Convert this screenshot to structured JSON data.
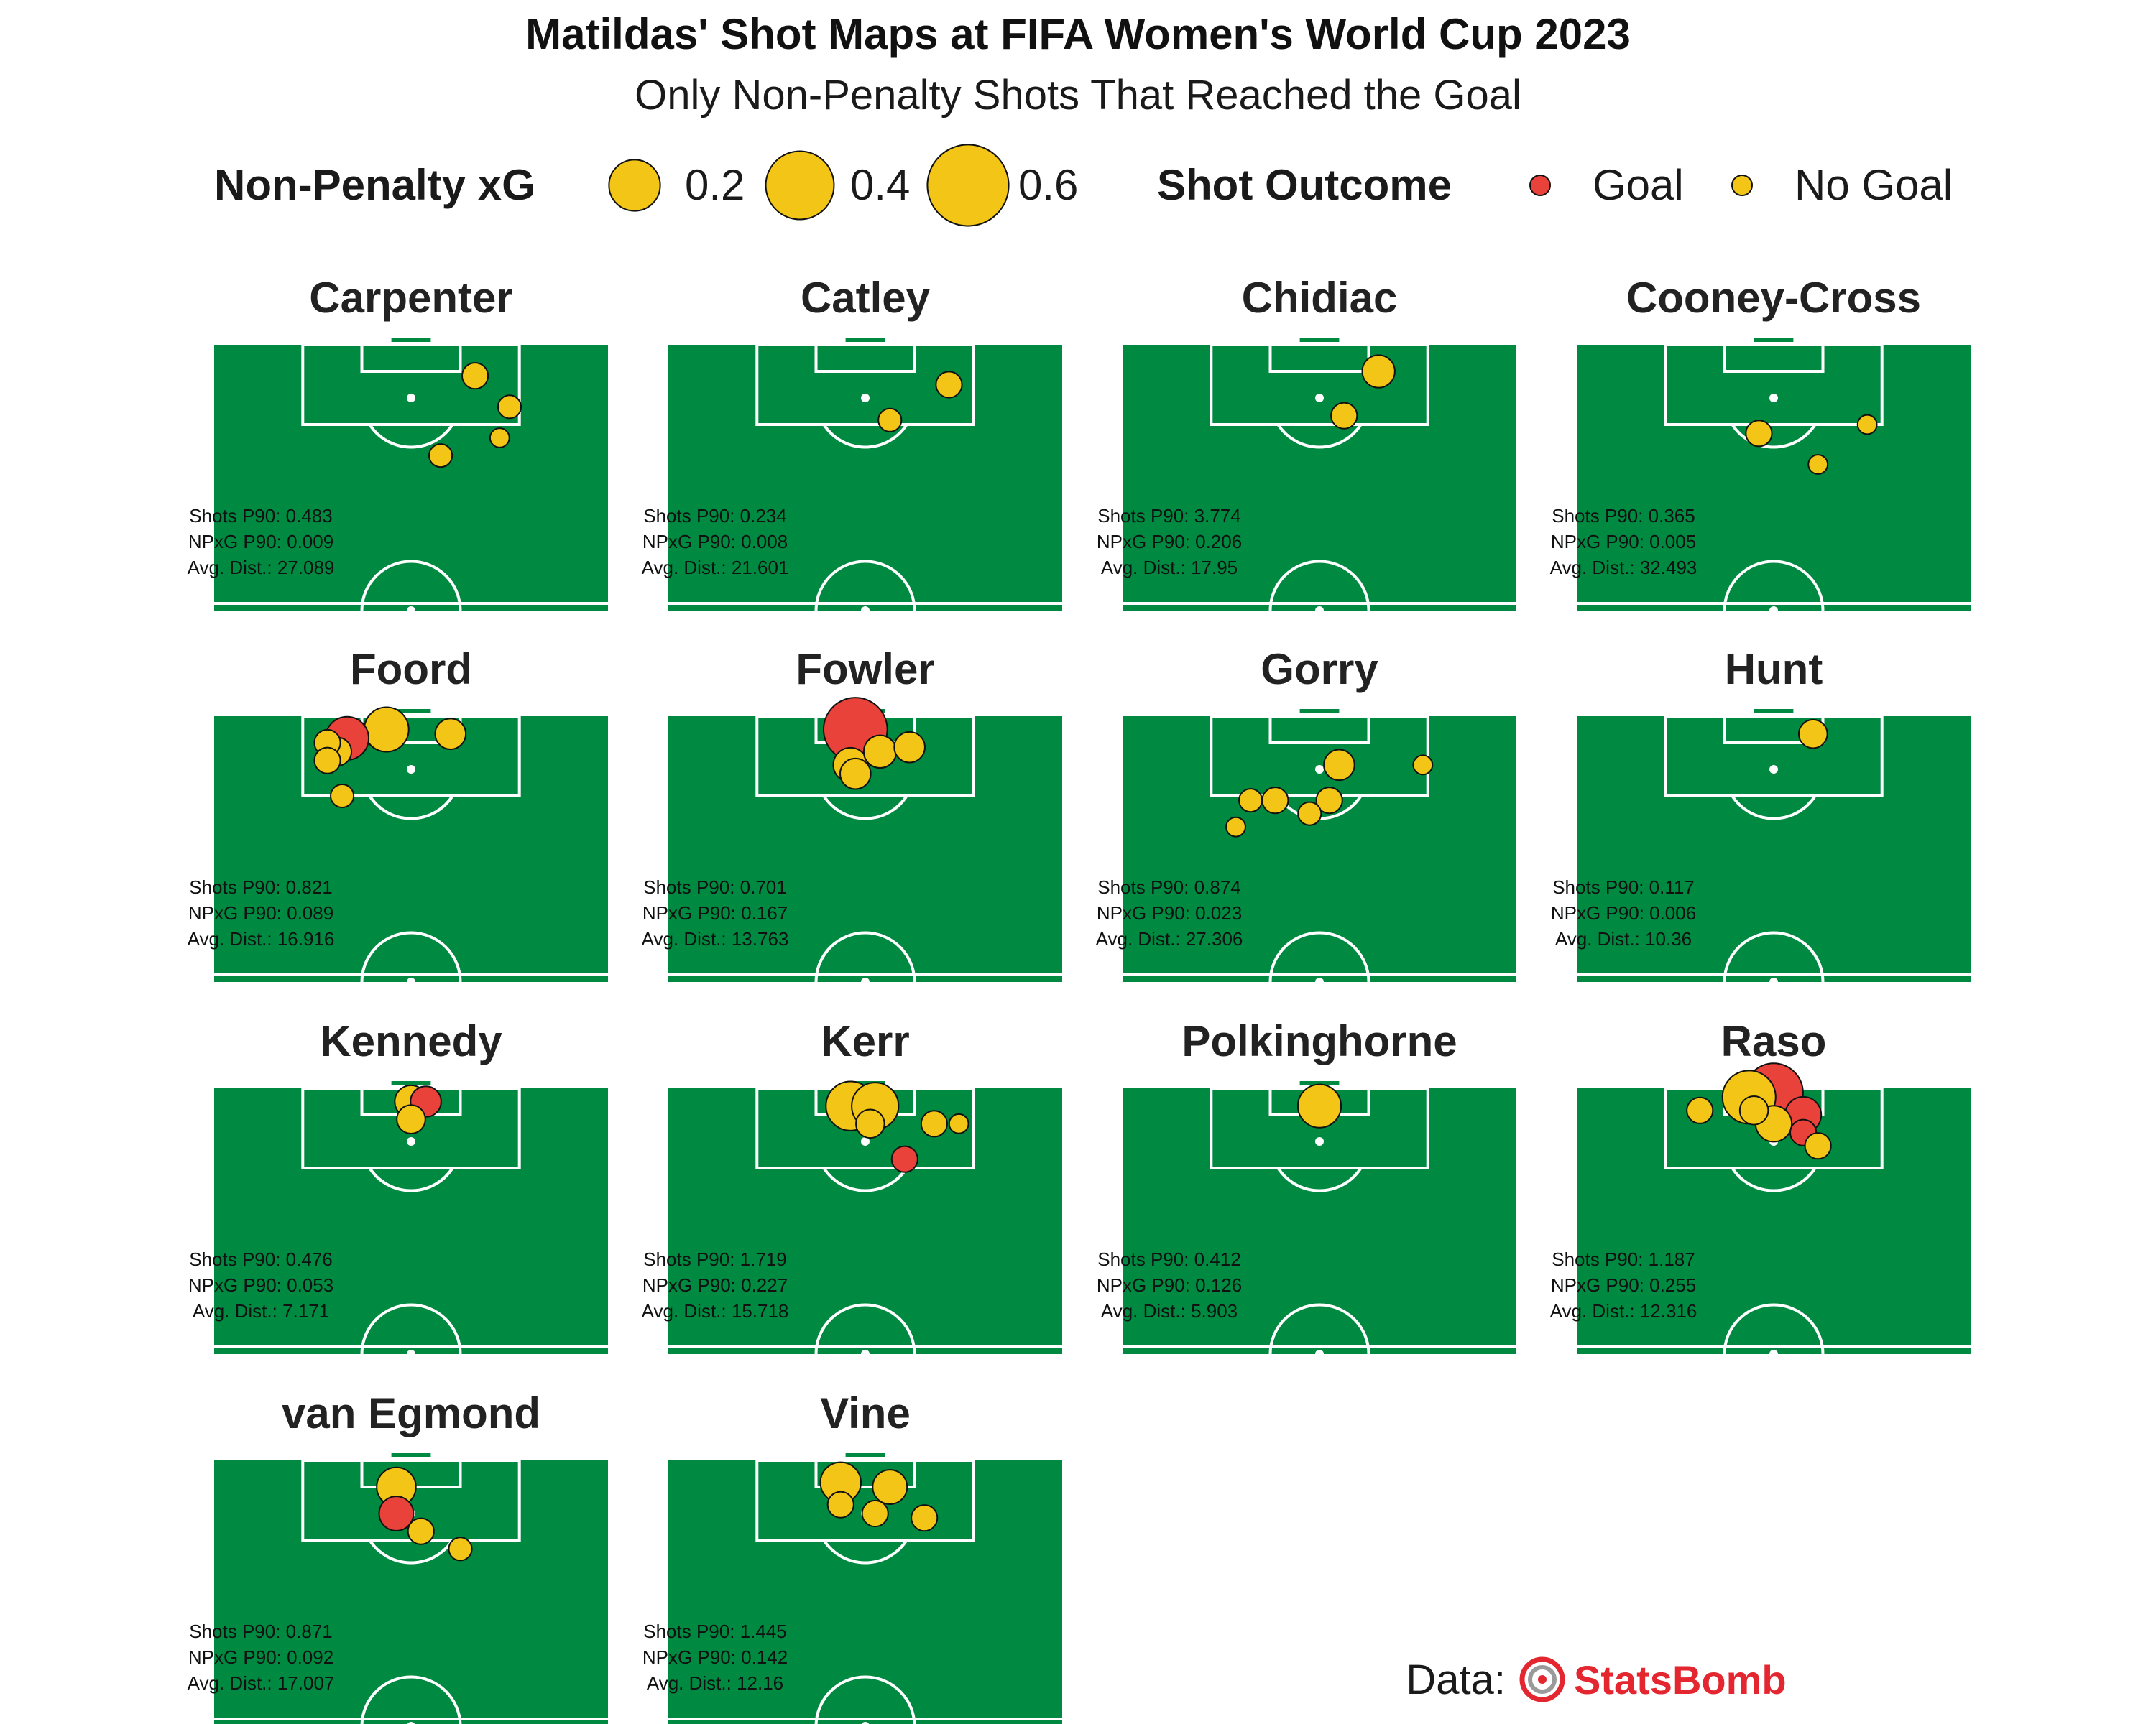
{
  "title": "Matildas' Shot Maps at FIFA Women's World Cup 2023",
  "subtitle": "Only Non-Penalty Shots That Reached the Goal",
  "legend": {
    "size_title": "Non-Penalty xG",
    "size_items": [
      {
        "label": "0.2",
        "value": 0.2
      },
      {
        "label": "0.4",
        "value": 0.4
      },
      {
        "label": "0.6",
        "value": 0.6
      }
    ],
    "color_title": "Shot Outcome",
    "color_items": [
      {
        "label": "Goal",
        "color": "#e8423a"
      },
      {
        "label": "No Goal",
        "color": "#f2c517"
      }
    ]
  },
  "colors": {
    "pitch": "#008940",
    "lines": "#ffffff",
    "goal": "#e8423a",
    "no_goal": "#f2c517"
  },
  "stat_labels": {
    "shots": "Shots P90: ",
    "npxg": "NPxG P90: ",
    "dist": "Avg. Dist.: "
  },
  "credit": {
    "prefix": "Data:",
    "brand": "StatsBomb",
    "logo_icon": "statsbomb-target-icon"
  },
  "chart_data": {
    "type": "scatter",
    "x_range": [
      0,
      80
    ],
    "y_range": [
      60,
      120
    ],
    "panels": [
      {
        "player": "Carpenter",
        "shots_p90": "0.483",
        "npxg_p90": "0.009",
        "avg_dist": "27.089",
        "shots": [
          {
            "x": 53,
            "y": 113,
            "xg": 0.03,
            "outcome": "No Goal"
          },
          {
            "x": 60,
            "y": 106,
            "xg": 0.02,
            "outcome": "No Goal"
          },
          {
            "x": 58,
            "y": 99,
            "xg": 0.01,
            "outcome": "No Goal"
          },
          {
            "x": 46,
            "y": 95,
            "xg": 0.02,
            "outcome": "No Goal"
          }
        ]
      },
      {
        "player": "Catley",
        "shots_p90": "0.234",
        "npxg_p90": "0.008",
        "avg_dist": "21.601",
        "shots": [
          {
            "x": 57,
            "y": 111,
            "xg": 0.03,
            "outcome": "No Goal"
          },
          {
            "x": 45,
            "y": 103,
            "xg": 0.02,
            "outcome": "No Goal"
          }
        ]
      },
      {
        "player": "Chidiac",
        "shots_p90": "3.774",
        "npxg_p90": "0.206",
        "avg_dist": "17.95",
        "shots": [
          {
            "x": 52,
            "y": 114,
            "xg": 0.06,
            "outcome": "No Goal"
          },
          {
            "x": 45,
            "y": 104,
            "xg": 0.03,
            "outcome": "No Goal"
          }
        ]
      },
      {
        "player": "Cooney-Cross",
        "shots_p90": "0.365",
        "npxg_p90": "0.005",
        "avg_dist": "32.493",
        "shots": [
          {
            "x": 37,
            "y": 100,
            "xg": 0.03,
            "outcome": "No Goal"
          },
          {
            "x": 59,
            "y": 102,
            "xg": 0.01,
            "outcome": "No Goal"
          },
          {
            "x": 49,
            "y": 93,
            "xg": 0.01,
            "outcome": "No Goal"
          }
        ]
      },
      {
        "player": "Foord",
        "shots_p90": "0.821",
        "npxg_p90": "0.089",
        "avg_dist": "16.916",
        "shots": [
          {
            "x": 35,
            "y": 117,
            "xg": 0.14,
            "outcome": "No Goal"
          },
          {
            "x": 27,
            "y": 115,
            "xg": 0.13,
            "outcome": "Goal"
          },
          {
            "x": 48,
            "y": 116,
            "xg": 0.05,
            "outcome": "No Goal"
          },
          {
            "x": 23,
            "y": 114,
            "xg": 0.03,
            "outcome": "No Goal"
          },
          {
            "x": 25,
            "y": 112,
            "xg": 0.04,
            "outcome": "No Goal"
          },
          {
            "x": 23,
            "y": 110,
            "xg": 0.03,
            "outcome": "No Goal"
          },
          {
            "x": 26,
            "y": 102,
            "xg": 0.02,
            "outcome": "No Goal"
          }
        ]
      },
      {
        "player": "Fowler",
        "shots_p90": "0.701",
        "npxg_p90": "0.167",
        "avg_dist": "13.763",
        "shots": [
          {
            "x": 38,
            "y": 117,
            "xg": 0.34,
            "outcome": "Goal"
          },
          {
            "x": 43,
            "y": 112,
            "xg": 0.06,
            "outcome": "No Goal"
          },
          {
            "x": 49,
            "y": 113,
            "xg": 0.05,
            "outcome": "No Goal"
          },
          {
            "x": 37,
            "y": 109,
            "xg": 0.07,
            "outcome": "No Goal"
          },
          {
            "x": 38,
            "y": 107,
            "xg": 0.05,
            "outcome": "No Goal"
          }
        ]
      },
      {
        "player": "Gorry",
        "shots_p90": "0.874",
        "npxg_p90": "0.023",
        "avg_dist": "27.306",
        "shots": [
          {
            "x": 44,
            "y": 109,
            "xg": 0.05,
            "outcome": "No Goal"
          },
          {
            "x": 61,
            "y": 109,
            "xg": 0.01,
            "outcome": "No Goal"
          },
          {
            "x": 26,
            "y": 101,
            "xg": 0.02,
            "outcome": "No Goal"
          },
          {
            "x": 31,
            "y": 101,
            "xg": 0.03,
            "outcome": "No Goal"
          },
          {
            "x": 42,
            "y": 101,
            "xg": 0.03,
            "outcome": "No Goal"
          },
          {
            "x": 38,
            "y": 98,
            "xg": 0.02,
            "outcome": "No Goal"
          },
          {
            "x": 23,
            "y": 95,
            "xg": 0.01,
            "outcome": "No Goal"
          }
        ]
      },
      {
        "player": "Hunt",
        "shots_p90": "0.117",
        "npxg_p90": "0.006",
        "avg_dist": "10.36",
        "shots": [
          {
            "x": 48,
            "y": 116,
            "xg": 0.04,
            "outcome": "No Goal"
          }
        ]
      },
      {
        "player": "Kennedy",
        "shots_p90": "0.476",
        "npxg_p90": "0.053",
        "avg_dist": "7.171",
        "shots": [
          {
            "x": 40,
            "y": 117,
            "xg": 0.06,
            "outcome": "No Goal"
          },
          {
            "x": 43,
            "y": 117,
            "xg": 0.05,
            "outcome": "Goal"
          },
          {
            "x": 40,
            "y": 113,
            "xg": 0.04,
            "outcome": "No Goal"
          }
        ]
      },
      {
        "player": "Kerr",
        "shots_p90": "1.719",
        "npxg_p90": "0.227",
        "avg_dist": "15.718",
        "shots": [
          {
            "x": 37,
            "y": 116,
            "xg": 0.18,
            "outcome": "No Goal"
          },
          {
            "x": 42,
            "y": 116,
            "xg": 0.16,
            "outcome": "No Goal"
          },
          {
            "x": 41,
            "y": 112,
            "xg": 0.04,
            "outcome": "No Goal"
          },
          {
            "x": 54,
            "y": 112,
            "xg": 0.03,
            "outcome": "No Goal"
          },
          {
            "x": 59,
            "y": 112,
            "xg": 0.01,
            "outcome": "No Goal"
          },
          {
            "x": 48,
            "y": 104,
            "xg": 0.03,
            "outcome": "Goal"
          }
        ]
      },
      {
        "player": "Polkinghorne",
        "shots_p90": "0.412",
        "npxg_p90": "0.126",
        "avg_dist": "5.903",
        "shots": [
          {
            "x": 40,
            "y": 116,
            "xg": 0.13,
            "outcome": "No Goal"
          }
        ]
      },
      {
        "player": "Raso",
        "shots_p90": "1.187",
        "npxg_p90": "0.255",
        "avg_dist": "12.316",
        "shots": [
          {
            "x": 40,
            "y": 119,
            "xg": 0.28,
            "outcome": "Goal"
          },
          {
            "x": 35,
            "y": 118,
            "xg": 0.22,
            "outcome": "No Goal"
          },
          {
            "x": 25,
            "y": 115,
            "xg": 0.03,
            "outcome": "No Goal"
          },
          {
            "x": 36,
            "y": 115,
            "xg": 0.04,
            "outcome": "No Goal"
          },
          {
            "x": 46,
            "y": 114,
            "xg": 0.08,
            "outcome": "Goal"
          },
          {
            "x": 40,
            "y": 112,
            "xg": 0.08,
            "outcome": "No Goal"
          },
          {
            "x": 46,
            "y": 110,
            "xg": 0.03,
            "outcome": "Goal"
          },
          {
            "x": 49,
            "y": 107,
            "xg": 0.03,
            "outcome": "No Goal"
          }
        ]
      },
      {
        "player": "van Egmond",
        "shots_p90": "0.871",
        "npxg_p90": "0.092",
        "avg_dist": "17.007",
        "shots": [
          {
            "x": 37,
            "y": 114,
            "xg": 0.1,
            "outcome": "No Goal"
          },
          {
            "x": 37,
            "y": 108,
            "xg": 0.07,
            "outcome": "Goal"
          },
          {
            "x": 42,
            "y": 104,
            "xg": 0.03,
            "outcome": "No Goal"
          },
          {
            "x": 50,
            "y": 100,
            "xg": 0.02,
            "outcome": "No Goal"
          }
        ]
      },
      {
        "player": "Vine",
        "shots_p90": "1.445",
        "npxg_p90": "0.142",
        "avg_dist": "12.16",
        "shots": [
          {
            "x": 35,
            "y": 115,
            "xg": 0.11,
            "outcome": "No Goal"
          },
          {
            "x": 45,
            "y": 114,
            "xg": 0.07,
            "outcome": "No Goal"
          },
          {
            "x": 35,
            "y": 110,
            "xg": 0.03,
            "outcome": "No Goal"
          },
          {
            "x": 42,
            "y": 108,
            "xg": 0.03,
            "outcome": "No Goal"
          },
          {
            "x": 52,
            "y": 107,
            "xg": 0.03,
            "outcome": "No Goal"
          }
        ]
      }
    ]
  }
}
